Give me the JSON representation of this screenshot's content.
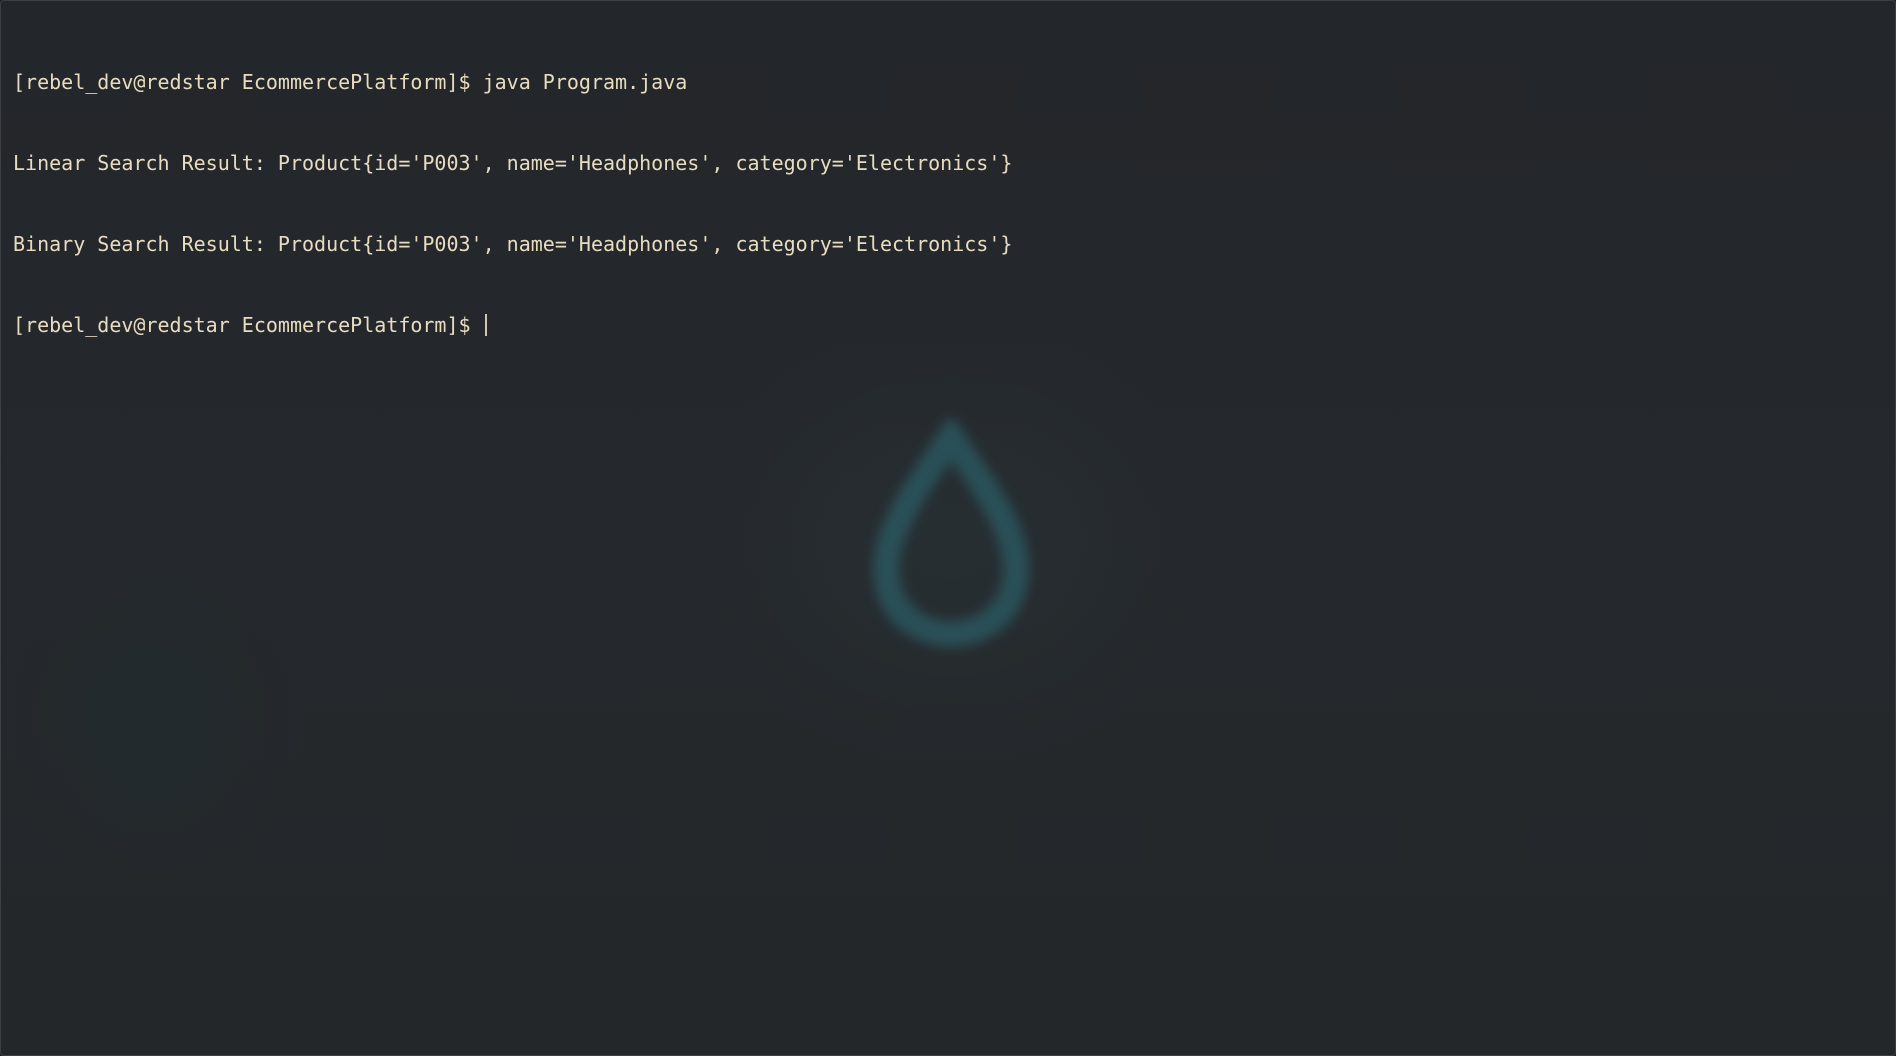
{
  "terminal": {
    "lines": [
      {
        "prompt": "[rebel_dev@redstar EcommercePlatform]$",
        "text": " java Program.java"
      },
      {
        "prompt": "",
        "text": "Linear Search Result: Product{id='P003', name='Headphones', category='Electronics'}"
      },
      {
        "prompt": "",
        "text": "Binary Search Result: Product{id='P003', name='Headphones', category='Electronics'}"
      },
      {
        "prompt": "[rebel_dev@redstar EcommercePlatform]$",
        "text": " "
      }
    ],
    "colors": {
      "text": "#e8dcc0",
      "background": "#24272a",
      "watermark": "#2d6e78"
    },
    "watermark_icon": "droplet-icon"
  }
}
